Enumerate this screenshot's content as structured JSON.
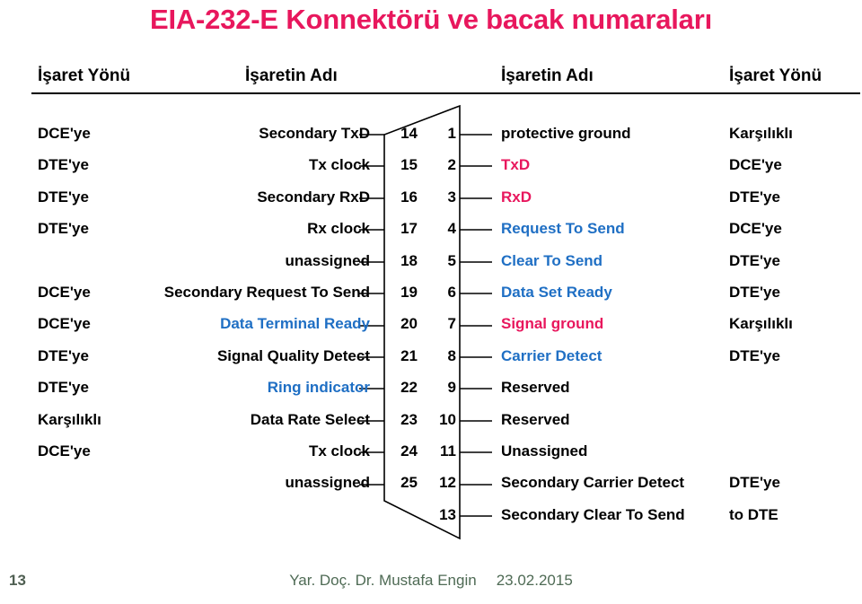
{
  "title": "EIA-232-E Konnektörü ve bacak numaraları",
  "headers": {
    "left_direction": "İşaret Yönü",
    "left_name": "İşaretin Adı",
    "right_name": "İşaretin Adı",
    "right_direction": "İşaret Yönü"
  },
  "colors": {
    "title": "#E8175D",
    "accent_blue": "#1F6FC4",
    "accent_pink": "#E8175D",
    "text": "#000000",
    "footer": "#4F6B55"
  },
  "rows": [
    {
      "left_direction": "DCE'ye",
      "left_name": "Secondary TxD",
      "left_name_color": "black",
      "left_pin": "14",
      "right_pin": "1",
      "right_name": "protective ground",
      "right_name_color": "black",
      "right_direction": "Karşılıklı"
    },
    {
      "left_direction": "DTE'ye",
      "left_name": "Tx clock",
      "left_name_color": "black",
      "left_pin": "15",
      "right_pin": "2",
      "right_name": "TxD",
      "right_name_color": "pink",
      "right_direction": "DCE'ye"
    },
    {
      "left_direction": "DTE'ye",
      "left_name": "Secondary RxD",
      "left_name_color": "black",
      "left_pin": "16",
      "right_pin": "3",
      "right_name": "RxD",
      "right_name_color": "pink",
      "right_direction": "DTE'ye"
    },
    {
      "left_direction": "DTE'ye",
      "left_name": "Rx clock",
      "left_name_color": "black",
      "left_pin": "17",
      "right_pin": "4",
      "right_name": "Request To Send",
      "right_name_color": "blue",
      "right_direction": "DCE'ye"
    },
    {
      "left_direction": "",
      "left_name": "unassigned",
      "left_name_color": "black",
      "left_pin": "18",
      "right_pin": "5",
      "right_name": "Clear To Send",
      "right_name_color": "blue",
      "right_direction": "DTE'ye"
    },
    {
      "left_direction": "DCE'ye",
      "left_name": "Secondary Request To Send",
      "left_name_color": "black",
      "left_pin": "19",
      "right_pin": "6",
      "right_name": "Data Set Ready",
      "right_name_color": "blue",
      "right_direction": "DTE'ye"
    },
    {
      "left_direction": "DCE'ye",
      "left_name": "Data Terminal Ready",
      "left_name_color": "blue",
      "left_pin": "20",
      "right_pin": "7",
      "right_name": "Signal ground",
      "right_name_color": "pink",
      "right_direction": "Karşılıklı"
    },
    {
      "left_direction": "DTE'ye",
      "left_name": "Signal Quality Detect",
      "left_name_color": "black",
      "left_pin": "21",
      "right_pin": "8",
      "right_name": "Carrier Detect",
      "right_name_color": "blue",
      "right_direction": "DTE'ye"
    },
    {
      "left_direction": "DTE'ye",
      "left_name": "Ring indicator",
      "left_name_color": "blue",
      "left_pin": "22",
      "right_pin": "9",
      "right_name": "Reserved",
      "right_name_color": "black",
      "right_direction": ""
    },
    {
      "left_direction": "Karşılıklı",
      "left_name": "Data Rate Select",
      "left_name_color": "black",
      "left_pin": "23",
      "right_pin": "10",
      "right_name": "Reserved",
      "right_name_color": "black",
      "right_direction": ""
    },
    {
      "left_direction": "DCE'ye",
      "left_name": "Tx clock",
      "left_name_color": "black",
      "left_pin": "24",
      "right_pin": "11",
      "right_name": "Unassigned",
      "right_name_color": "black",
      "right_direction": ""
    },
    {
      "left_direction": "",
      "left_name": "unassigned",
      "left_name_color": "black",
      "left_pin": "25",
      "right_pin": "12",
      "right_name": "Secondary Carrier Detect",
      "right_name_color": "black",
      "right_direction": "DTE'ye"
    },
    {
      "left_direction": "",
      "left_name": "",
      "left_name_color": "black",
      "left_pin": "",
      "right_pin": "13",
      "right_name": "Secondary Clear To Send",
      "right_name_color": "black",
      "right_direction": "to DTE"
    }
  ],
  "footer": {
    "page_number": "13",
    "credit": "Yar. Doç. Dr. Mustafa Engin",
    "date": "23.02.2015"
  }
}
